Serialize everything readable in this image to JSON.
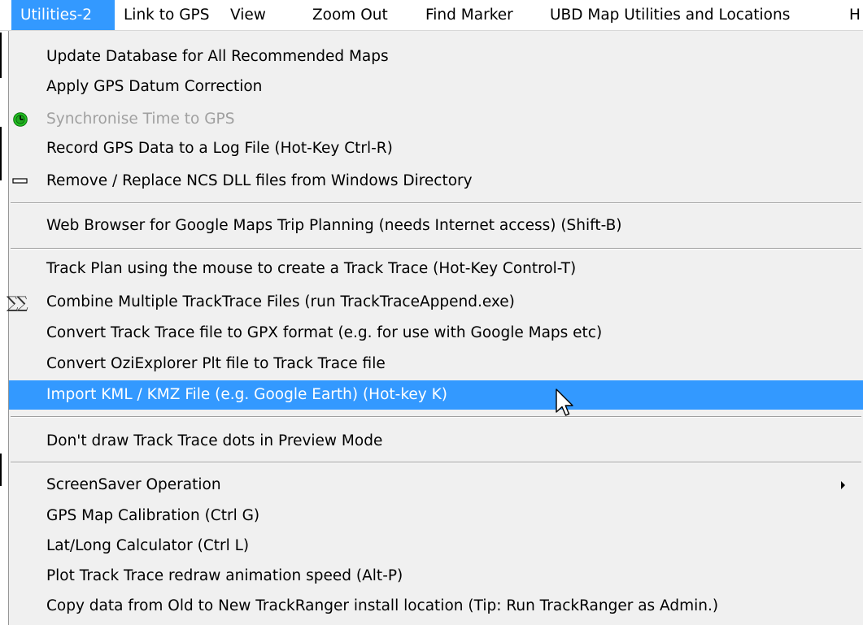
{
  "menubar": {
    "items": [
      {
        "label": "Utilities-2",
        "active": true
      },
      {
        "label": "Link to GPS"
      },
      {
        "label": "View"
      },
      {
        "label": "Zoom Out"
      },
      {
        "label": "Find Marker"
      },
      {
        "label": "UBD Map Utilities and Locations"
      },
      {
        "label": "H"
      }
    ]
  },
  "menu": {
    "items": [
      {
        "label": "Update Database for All Recommended Maps"
      },
      {
        "label": "Apply GPS Datum Correction"
      },
      {
        "label": "Synchronise Time to GPS",
        "disabled": true,
        "icon": "clock-icon"
      },
      {
        "label": "Record GPS Data to a Log File (Hot-Key Ctrl-R)"
      },
      {
        "label": "Remove / Replace NCS DLL files from Windows Directory",
        "icon": "dash-icon"
      },
      {
        "label": "Web Browser for Google Maps Trip Planning (needs Internet access) (Shift-B)"
      },
      {
        "label": "Track Plan using the mouse to create a Track Trace (Hot-Key Control-T)"
      },
      {
        "label": "Combine Multiple TrackTrace Files (run TrackTraceAppend.exe)",
        "icon": "sigma-icon",
        "icon_text": "∑∑"
      },
      {
        "label": "Convert Track Trace file to GPX format (e.g. for use with Google Maps etc)"
      },
      {
        "label": "Convert OziExplorer Plt file to Track Trace file"
      },
      {
        "label": "Import KML / KMZ File  (e.g. Google Earth) (Hot-key K)",
        "highlighted": true
      },
      {
        "label": "Don't draw Track Trace dots in Preview Mode"
      },
      {
        "label": "ScreenSaver Operation",
        "submenu": true
      },
      {
        "label": "GPS Map Calibration (Ctrl G)"
      },
      {
        "label": "Lat/Long Calculator (Ctrl L)"
      },
      {
        "label": "Plot Track Trace redraw animation speed (Alt-P)"
      },
      {
        "label": "Copy data from Old to New TrackRanger install location (Tip: Run TrackRanger as Admin.)"
      }
    ]
  },
  "colors": {
    "highlight": "#3399ff",
    "menu_background": "#f0f0f0",
    "disabled_text": "#a0a0a0",
    "clock_green": "#22c322"
  }
}
